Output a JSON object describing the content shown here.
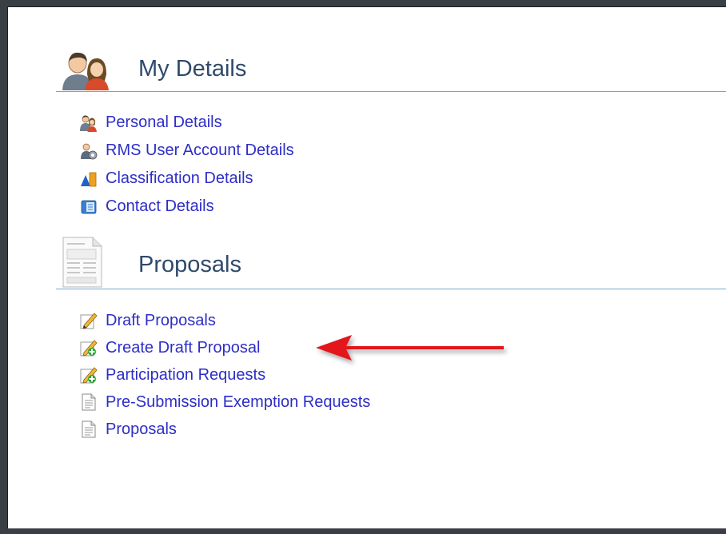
{
  "my_details": {
    "title": "My Details",
    "links": [
      {
        "label": "Personal Details",
        "icon": "users-icon"
      },
      {
        "label": "RMS User Account Details",
        "icon": "user-settings-icon"
      },
      {
        "label": "Classification Details",
        "icon": "shapes-icon"
      },
      {
        "label": "Contact Details",
        "icon": "phone-book-icon"
      }
    ]
  },
  "proposals": {
    "title": "Proposals",
    "links": [
      {
        "label": "Draft Proposals",
        "icon": "pencil-document-icon"
      },
      {
        "label": "Create Draft Proposal",
        "icon": "pencil-document-add-icon"
      },
      {
        "label": "Participation Requests",
        "icon": "pencil-document-add-icon"
      },
      {
        "label": "Pre-Submission Exemption Requests",
        "icon": "document-icon"
      },
      {
        "label": "Proposals",
        "icon": "document-icon"
      }
    ]
  },
  "colors": {
    "link": "#2d2dc8",
    "heading": "#2f4a6b",
    "rule": "#7aa6c8",
    "annotation_arrow": "#e3141b"
  }
}
